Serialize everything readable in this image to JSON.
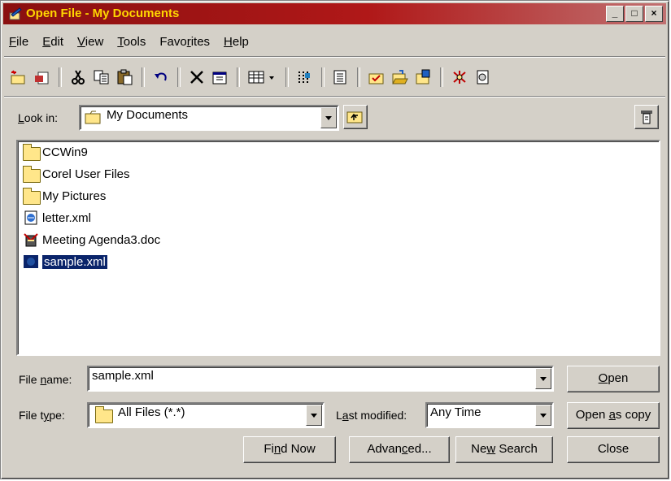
{
  "window": {
    "title": "Open File - My Documents",
    "controls": [
      "_",
      "□",
      "×"
    ]
  },
  "menubar": [
    {
      "label": "File",
      "accel": "F",
      "rest": "ile"
    },
    {
      "label": "Edit",
      "accel": "E",
      "rest": "dit"
    },
    {
      "label": "View",
      "accel": "V",
      "rest": "iew"
    },
    {
      "label": "Tools",
      "accel": "T",
      "rest": "ools"
    },
    {
      "label": "Favorites",
      "pre": "Favo",
      "accel": "r",
      "rest": "ites"
    },
    {
      "label": "Help",
      "accel": "H",
      "rest": "elp"
    }
  ],
  "toolbar": {
    "icons": [
      "new-folder-icon",
      "new-document-icon",
      "cut-icon",
      "copy-icon",
      "paste-icon",
      "undo-icon",
      "delete-icon",
      "properties-icon",
      "views-icon",
      "list-icon",
      "details-icon",
      "check-folder-icon",
      "open-folder-icon",
      "move-folder-icon",
      "network-icon",
      "document-icon"
    ]
  },
  "look_in": {
    "label_pre": "",
    "label_accel": "L",
    "label_rest": "ook in:",
    "value": "My Documents"
  },
  "files": [
    {
      "name": "CCWin9",
      "type": "folder"
    },
    {
      "name": "Corel User Files",
      "type": "folder"
    },
    {
      "name": "My Pictures",
      "type": "folder"
    },
    {
      "name": "letter.xml",
      "type": "xml"
    },
    {
      "name": "Meeting Agenda3.doc",
      "type": "doc"
    },
    {
      "name": "sample.xml",
      "type": "xml",
      "selected": true
    }
  ],
  "file_name": {
    "label_pre": "File ",
    "label_accel": "n",
    "label_rest": "ame:",
    "value": "sample.xml"
  },
  "file_type": {
    "label_pre": "File t",
    "label_accel": "y",
    "label_rest": "pe:",
    "value": "All Files (*.*)"
  },
  "last_modified": {
    "label_pre": "L",
    "label_accel": "a",
    "label_rest": "st modified:",
    "value": "Any Time"
  },
  "buttons": {
    "open": {
      "pre": "",
      "accel": "O",
      "rest": "pen"
    },
    "open_copy": {
      "pre": "Open ",
      "accel": "a",
      "rest": "s copy"
    },
    "find_now": {
      "pre": "Fi",
      "accel": "n",
      "rest": "d Now"
    },
    "advanced": {
      "pre": "Advan",
      "accel": "c",
      "rest": "ed..."
    },
    "new_search": {
      "pre": "Ne",
      "accel": "w",
      "rest": " Search"
    },
    "close": {
      "pre": "Close",
      "accel": "",
      "rest": ""
    }
  },
  "colors": {
    "title_bar": "#a01414",
    "title_text": "#ffd700",
    "selection": "#0a246a",
    "face": "#d4d0c8"
  }
}
